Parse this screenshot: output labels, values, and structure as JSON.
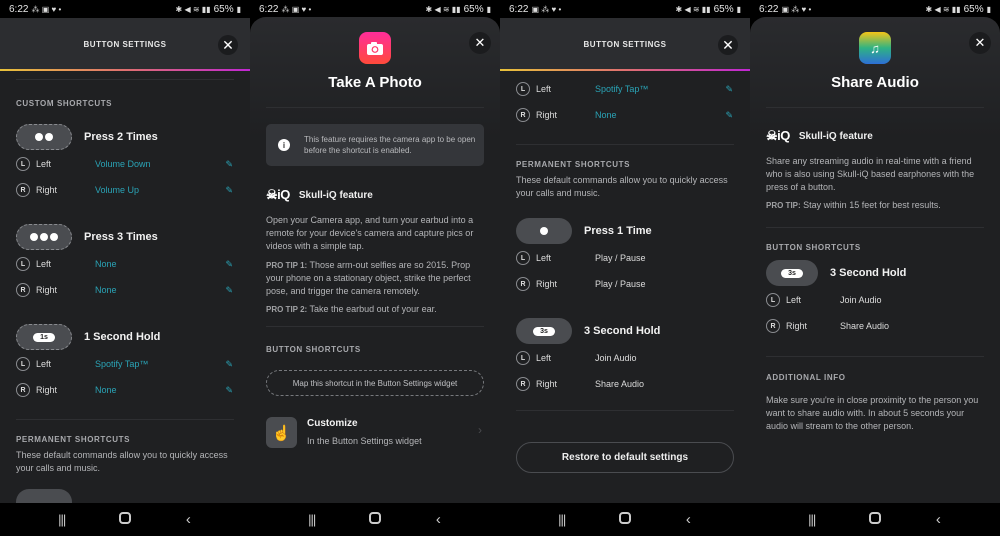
{
  "status_bar": {
    "time": "6:22",
    "battery": "65%"
  },
  "nav": {
    "recent": "|||",
    "home": "",
    "back": "‹"
  },
  "icons": {
    "close": "✕",
    "edit": "✎",
    "info": "i",
    "chevron": "›",
    "tap": "☝",
    "camera": "📷",
    "share_audio": "♫"
  },
  "screen1": {
    "header_title": "BUTTON SETTINGS",
    "custom_label": "CUSTOM SHORTCUTS",
    "groups": [
      {
        "title": "Press 2 Times",
        "left": "Volume Down",
        "right": "Volume Up"
      },
      {
        "title": "Press 3 Times",
        "left": "None",
        "right": "None"
      },
      {
        "title": "1 Second Hold",
        "tag": "1s",
        "left": "Spotify Tap™",
        "right": "None"
      }
    ],
    "permanent_label": "PERMANENT SHORTCUTS",
    "permanent_desc": "These default commands allow you to quickly access your calls and music."
  },
  "sides": {
    "left_badge": "L",
    "right_badge": "R",
    "left": "Left",
    "right": "Right"
  },
  "screen2": {
    "title": "Take A Photo",
    "info": "This feature requires the camera app to be open before the shortcut is enabled.",
    "iq_logo": "☠iQ",
    "iq_label": "Skull-iQ feature",
    "desc": "Open your Camera app, and turn your earbud into a remote for your device's camera and capture pics or videos with a simple tap.",
    "tip1_label": "PRO TIP 1:",
    "tip1": " Those arm-out selfies are so 2015. Prop your phone on a stationary object, strike the perfect pose, and trigger the camera remotely.",
    "tip2_label": "PRO TIP 2:",
    "tip2": " Take the earbud out of your ear.",
    "shortcuts_label": "BUTTON SHORTCUTS",
    "map_hint": "Map this shortcut in the Button Settings widget",
    "customize_title": "Customize",
    "customize_sub": "In the Button Settings widget"
  },
  "screen3": {
    "header_title": "BUTTON SETTINGS",
    "top_group": {
      "left": "Spotify Tap™",
      "right": "None"
    },
    "permanent_label": "PERMANENT SHORTCUTS",
    "permanent_desc": "These default commands allow you to quickly access your calls and music.",
    "groups": [
      {
        "title": "Press 1 Time",
        "left": "Play / Pause",
        "right": "Play / Pause"
      },
      {
        "title": "3 Second Hold",
        "tag": "3s",
        "left": "Join Audio",
        "right": "Share Audio"
      }
    ],
    "restore": "Restore to default settings"
  },
  "screen4": {
    "title": "Share Audio",
    "iq_logo": "☠iQ",
    "iq_label": "Skull-iQ feature",
    "desc": "Share any streaming audio in real-time with a friend who is also using Skull-iQ based earphones with the press of a button.",
    "tip_label": "PRO TIP:",
    "tip": " Stay within 15 feet for best results.",
    "shortcuts_label": "BUTTON SHORTCUTS",
    "group": {
      "title": "3 Second Hold",
      "tag": "3s",
      "left": "Join Audio",
      "right": "Share Audio"
    },
    "additional_label": "ADDITIONAL INFO",
    "additional": "Make sure you're in close proximity to the person you want to share audio with. In about 5 seconds your audio will stream to the other person."
  }
}
